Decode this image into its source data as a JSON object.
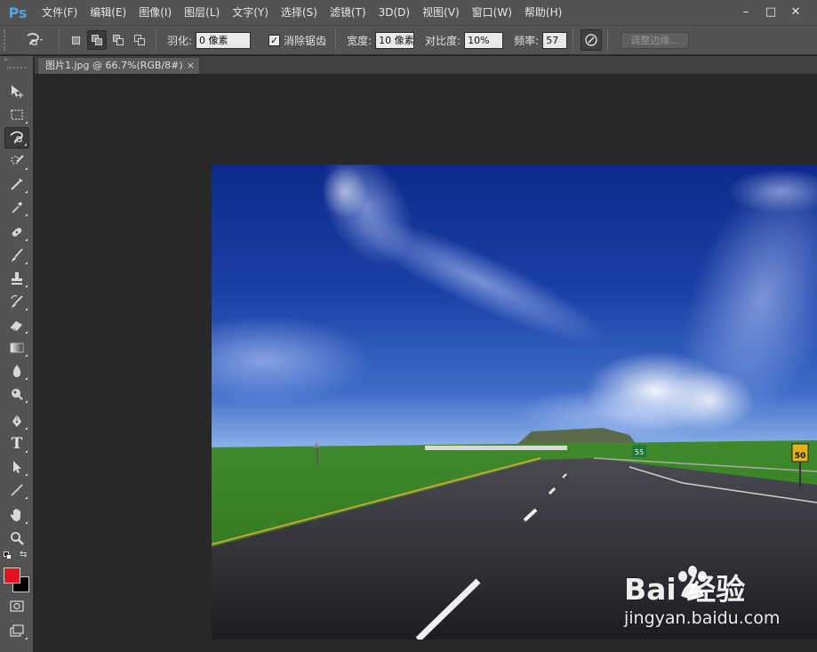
{
  "app": {
    "logo": "Ps"
  },
  "menu": [
    {
      "label": "文件(F)"
    },
    {
      "label": "编辑(E)"
    },
    {
      "label": "图像(I)"
    },
    {
      "label": "图层(L)"
    },
    {
      "label": "文字(Y)"
    },
    {
      "label": "选择(S)"
    },
    {
      "label": "滤镜(T)"
    },
    {
      "label": "3D(D)"
    },
    {
      "label": "视图(V)"
    },
    {
      "label": "窗口(W)"
    },
    {
      "label": "帮助(H)"
    }
  ],
  "window_controls": {
    "minimize": "–",
    "restore": "□",
    "close": "✕"
  },
  "options": {
    "feather_label": "羽化:",
    "feather_value": "0 像素",
    "antialias_label": "消除锯齿",
    "antialias_checked": "✓",
    "width_label": "宽度:",
    "width_value": "10 像素",
    "contrast_label": "对比度:",
    "contrast_value": "10%",
    "frequency_label": "频率:",
    "frequency_value": "57",
    "refine_edge": "调整边缘..."
  },
  "toolbar": {
    "collapse": "»",
    "tools": [
      {
        "name": "move"
      },
      {
        "name": "rectangular-marquee"
      },
      {
        "name": "magnetic-lasso",
        "active": true
      },
      {
        "name": "quick-selection"
      },
      {
        "name": "crop"
      },
      {
        "name": "eyedropper"
      },
      {
        "name": "healing-brush"
      },
      {
        "name": "brush"
      },
      {
        "name": "clone-stamp"
      },
      {
        "name": "history-brush"
      },
      {
        "name": "eraser"
      },
      {
        "name": "gradient"
      },
      {
        "name": "blur"
      },
      {
        "name": "dodge"
      },
      {
        "name": "pen"
      },
      {
        "name": "type",
        "glyph": "T"
      },
      {
        "name": "path-selection"
      },
      {
        "name": "line"
      },
      {
        "name": "hand"
      },
      {
        "name": "zoom"
      }
    ],
    "foreground_color": "#e8111f",
    "background_color": "#000000"
  },
  "document": {
    "tab_title": "图片1.jpg @ 66.7%(RGB/8#)",
    "close": "×"
  },
  "image": {
    "exit_sign_number": "55",
    "speed_sign_number": "50"
  },
  "watermark": {
    "brand": "Bai 经验",
    "url": "jingyan.baidu.com"
  }
}
